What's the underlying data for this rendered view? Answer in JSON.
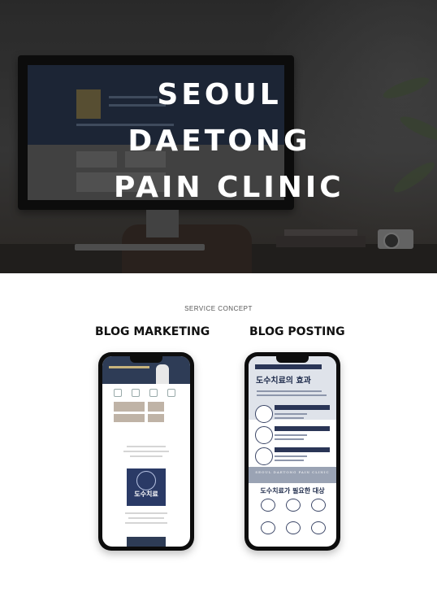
{
  "hero": {
    "title_lines": [
      "SEOUL",
      "DAETONG",
      "PAIN CLINIC"
    ]
  },
  "section": {
    "label": "SERVICE CONCEPT",
    "columns": [
      {
        "title": "BLOG MARKETING"
      },
      {
        "title": "BLOG POSTING"
      }
    ]
  },
  "left_phone": {
    "poster_text": "도수치료"
  },
  "right_phone": {
    "headline": "도수치료의 효과",
    "band_text": "SEOUL DAETONG PAIN CLINIC",
    "subheadline": "도수치료가 필요한 대상"
  },
  "colors": {
    "navy": "#2a3556",
    "hero_text": "#ffffff"
  }
}
